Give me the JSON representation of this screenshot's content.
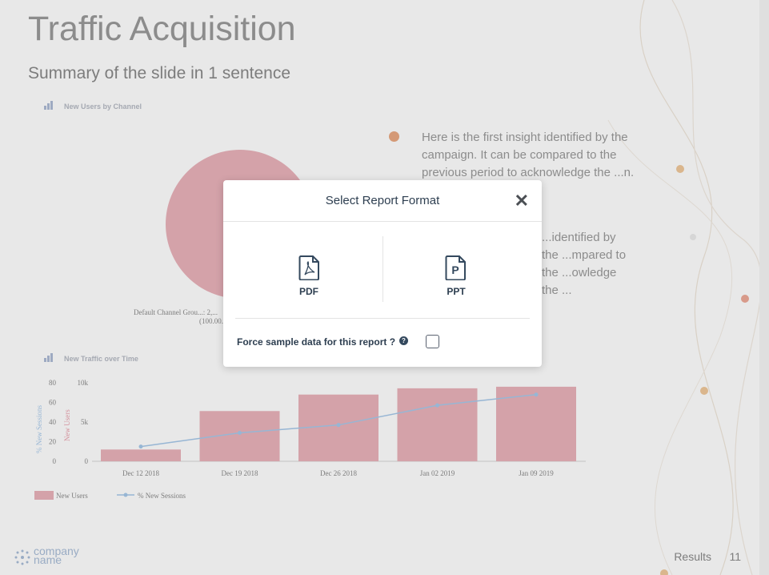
{
  "slide": {
    "title": "Traffic Acquisition",
    "subtitle": "Summary of the slide in 1 sentence",
    "insights": [
      "Here is the first insight identified by the campaign. It can be compared to the previous period to acknowledge the ...n.",
      "...identified by the ...mpared to the ...owledge the ..."
    ],
    "footer": {
      "section": "Results",
      "page": "11"
    },
    "logo": {
      "line1": "company",
      "line2": "name"
    }
  },
  "colors": {
    "bar": "#e9b3ba",
    "line": "#a6c8ea",
    "accent": "#e9a982",
    "modal_text": "#2d3e50"
  },
  "chart_data": [
    {
      "type": "pie",
      "title": "New Users by Channel",
      "slices": [
        {
          "label": "Default Channel Grou...: 2,...",
          "value": 100,
          "percent_label": "(100.00...)"
        }
      ]
    },
    {
      "type": "bar",
      "title": "New Traffic over Time",
      "categories": [
        "Dec 12 2018",
        "Dec 19 2018",
        "Dec 26 2018",
        "Jan 02 2019",
        "Jan 09 2019"
      ],
      "series": [
        {
          "name": "New Users",
          "type": "bar",
          "axis": "right",
          "values": [
            1500,
            6400,
            8500,
            9300,
            9500
          ]
        },
        {
          "name": "% New Sessions",
          "type": "line",
          "axis": "left",
          "values": [
            15,
            29,
            37,
            57,
            68
          ]
        }
      ],
      "y_right": {
        "label": "New Users",
        "ticks": [
          "0",
          "5k",
          "10k"
        ],
        "lim": [
          0,
          10000
        ]
      },
      "y_left": {
        "label": "% New Sessions",
        "ticks": [
          "0",
          "20",
          "40",
          "60",
          "80"
        ],
        "lim": [
          0,
          80
        ]
      },
      "legend": [
        "New Users",
        "% New Sessions"
      ]
    }
  ],
  "modal": {
    "title": "Select Report Format",
    "close_icon": "close-icon",
    "options": [
      {
        "label": "PDF",
        "icon": "pdf-file-icon"
      },
      {
        "label": "PPT",
        "icon": "ppt-file-icon"
      }
    ],
    "force_label": "Force sample data for this report ?",
    "force_checked": false
  }
}
